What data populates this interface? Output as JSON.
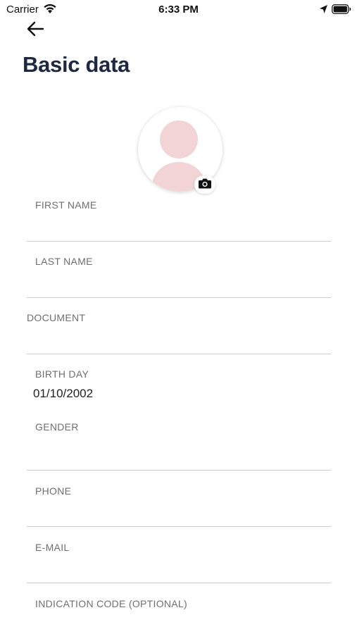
{
  "status_bar": {
    "carrier": "Carrier",
    "time": "6:33 PM",
    "icons": [
      "wifi-icon",
      "location-arrow-icon",
      "battery-icon"
    ]
  },
  "header": {
    "back_icon": "arrow-left-icon",
    "title": "Basic data"
  },
  "avatar": {
    "placeholder_icon": "user-silhouette-icon",
    "camera_icon": "camera-icon",
    "placeholder_color": "#f2d3d6"
  },
  "form": {
    "first_name": {
      "label": "FIRST NAME",
      "value": ""
    },
    "last_name": {
      "label": "LAST NAME",
      "value": ""
    },
    "document": {
      "label": "DOCUMENT",
      "value": ""
    },
    "birth_day": {
      "label": "BIRTH DAY",
      "value": "01/10/2002"
    },
    "gender": {
      "label": "GENDER",
      "value": ""
    },
    "phone": {
      "label": "PHONE",
      "value": ""
    },
    "email": {
      "label": "E-MAIL",
      "value": ""
    },
    "indication_code": {
      "label": "INDICATION CODE (OPTIONAL)",
      "value": ""
    }
  },
  "colors": {
    "title": "#1e2840",
    "label": "#6f6f6f",
    "divider": "#cfcfcf",
    "avatar_placeholder": "#f2d3d6"
  }
}
